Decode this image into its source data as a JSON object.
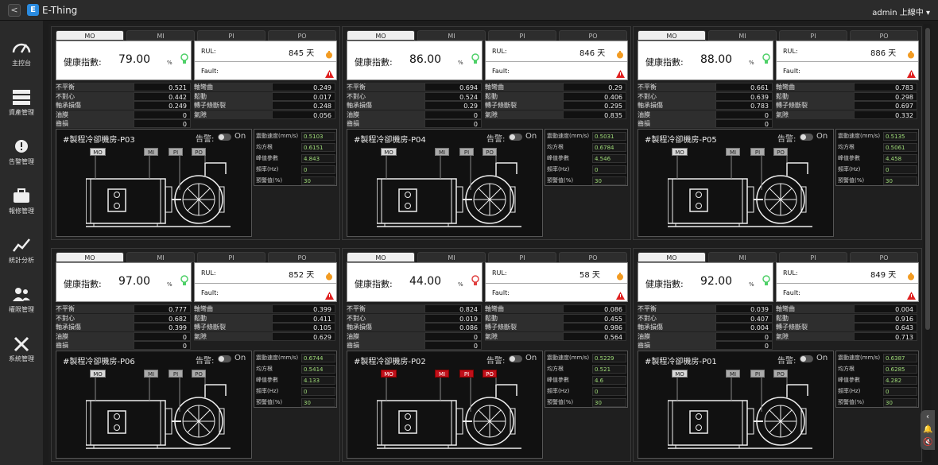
{
  "app": {
    "title": "E-Thing",
    "user": "admin 上線中"
  },
  "sidebar": [
    {
      "label": "主控台",
      "icon": "gauge-icon"
    },
    {
      "label": "資產管理",
      "icon": "server-icon"
    },
    {
      "label": "告警管理",
      "icon": "alert-gear-icon"
    },
    {
      "label": "報修管理",
      "icon": "toolbox-icon"
    },
    {
      "label": "統計分析",
      "icon": "chart-line-icon"
    },
    {
      "label": "權限管理",
      "icon": "users-icon"
    },
    {
      "label": "系統管理",
      "icon": "tools-icon"
    }
  ],
  "labels": {
    "tabs": [
      "MO",
      "MI",
      "PI",
      "PO"
    ],
    "health": "健康指數:",
    "unit_pct": "%",
    "rul": "RUL:",
    "fault": "Fault:",
    "days": "天",
    "alarm": "告警:",
    "on": "On",
    "chips": [
      "MO",
      "MI",
      "PI",
      "PO"
    ],
    "left_metrics": [
      "不平衡",
      "不對心",
      "軸承損傷",
      "油膜",
      "齒損"
    ],
    "right_metrics": [
      "軸彎曲",
      "鬆動",
      "轉子條斷裂",
      "氣隙"
    ],
    "vib": [
      "震動速度(mm/s)",
      "均方根",
      "峰值參數",
      "頻率(Hz)",
      "預警值(%)"
    ]
  },
  "panels": [
    {
      "name": "#製程冷卻機房-P03",
      "health": "79.00",
      "rul": "845",
      "left": [
        "0.521",
        "0.442",
        "0.249",
        "0",
        "0"
      ],
      "right": [
        "0.249",
        "0.017",
        "0.248",
        "0.056"
      ],
      "vib": [
        "0.5103",
        "0.6151",
        "4.843",
        "0",
        "30"
      ],
      "bulb": "#4ed068",
      "chip_alarm": false
    },
    {
      "name": "#製程冷卻機房-P04",
      "health": "86.00",
      "rul": "846",
      "left": [
        "0.694",
        "0.524",
        "0.29",
        "0",
        "0"
      ],
      "right": [
        "0.29",
        "0.406",
        "0.295",
        "0.835"
      ],
      "vib": [
        "0.5031",
        "0.6784",
        "4.546",
        "0",
        "30"
      ],
      "bulb": "#4ed068",
      "chip_alarm": false
    },
    {
      "name": "#製程冷卻機房-P05",
      "health": "88.00",
      "rul": "886",
      "left": [
        "0.661",
        "0.639",
        "0.783",
        "0",
        "0"
      ],
      "right": [
        "0.783",
        "0.298",
        "0.697",
        "0.332"
      ],
      "vib": [
        "0.5135",
        "0.5061",
        "4.458",
        "0",
        "30"
      ],
      "bulb": "#4ed068",
      "chip_alarm": false
    },
    {
      "name": "#製程冷卻機房-P06",
      "health": "97.00",
      "rul": "852",
      "left": [
        "0.777",
        "0.682",
        "0.399",
        "0",
        "0"
      ],
      "right": [
        "0.399",
        "0.411",
        "0.105",
        "0.629"
      ],
      "vib": [
        "0.6744",
        "0.5414",
        "4.133",
        "0",
        "30"
      ],
      "bulb": "#4ed068",
      "chip_alarm": false
    },
    {
      "name": "#製程冷卻機房-P02",
      "health": "44.00",
      "rul": "58",
      "left": [
        "0.824",
        "0.019",
        "0.086",
        "0",
        "0"
      ],
      "right": [
        "0.086",
        "0.455",
        "0.986",
        "0.564"
      ],
      "vib": [
        "0.5229",
        "0.521",
        "4.6",
        "0",
        "30"
      ],
      "bulb": "#e04040",
      "chip_alarm": true
    },
    {
      "name": "#製程冷卻機房-P01",
      "health": "92.00",
      "rul": "849",
      "left": [
        "0.039",
        "0.407",
        "0.004",
        "0",
        "0"
      ],
      "right": [
        "0.004",
        "0.916",
        "0.643",
        "0.713"
      ],
      "vib": [
        "0.6387",
        "0.6285",
        "4.282",
        "0",
        "30"
      ],
      "bulb": "#4ed068",
      "chip_alarm": false
    }
  ]
}
